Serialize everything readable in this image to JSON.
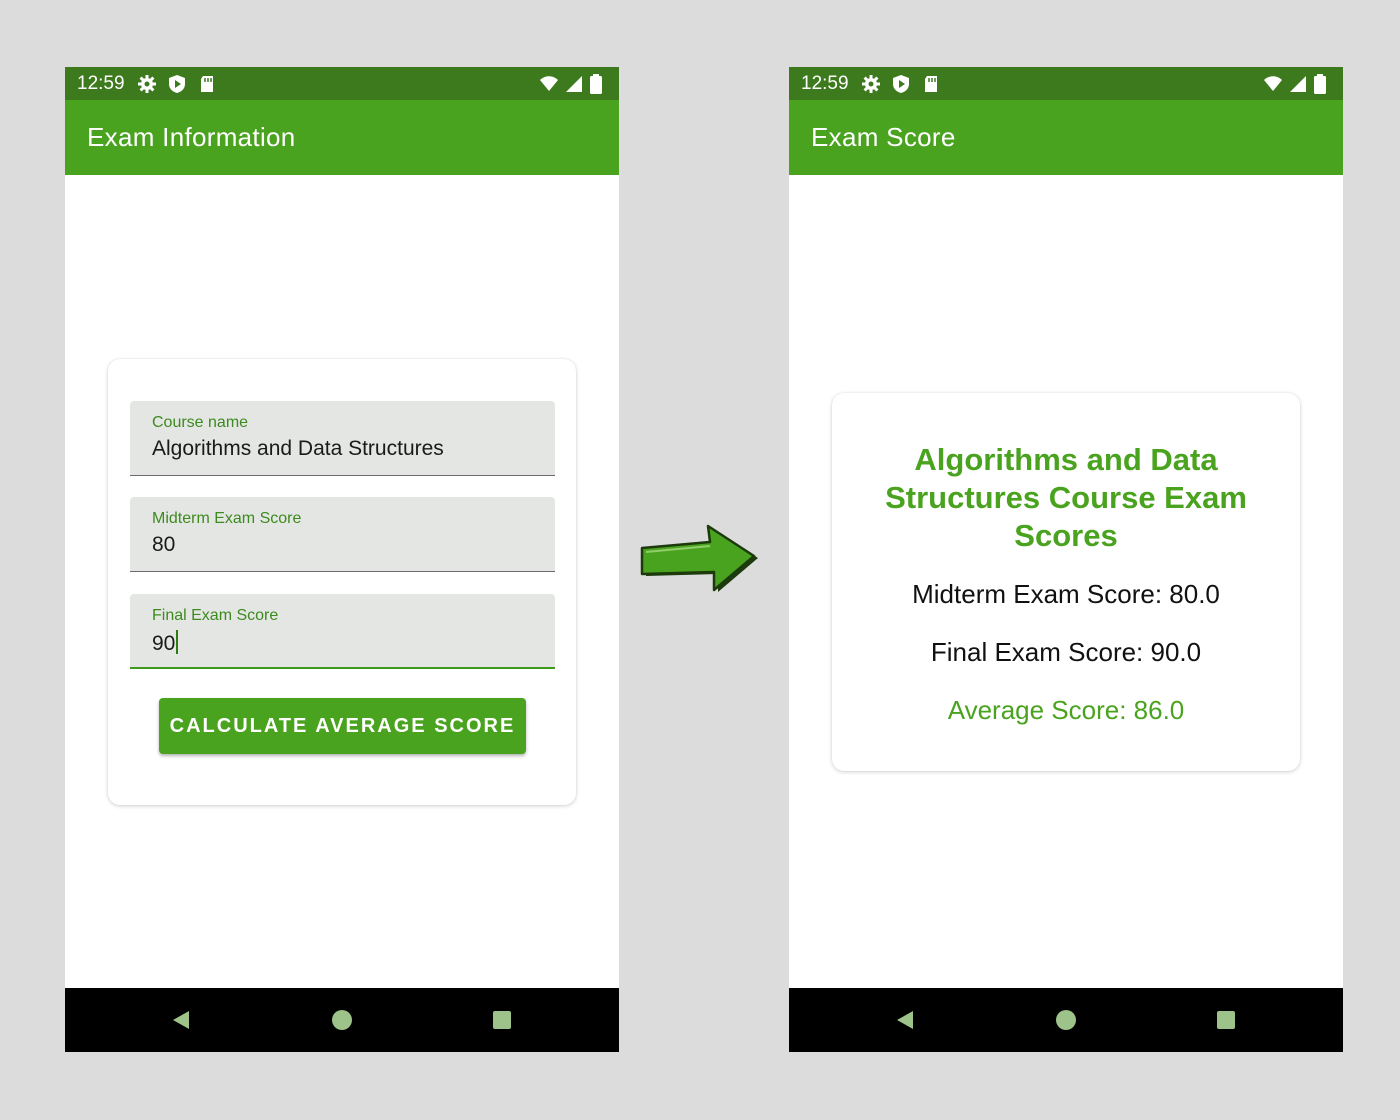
{
  "left_screen": {
    "status_time": "12:59",
    "app_title": "Exam Information",
    "fields": [
      {
        "label": "Course name",
        "value": "Algorithms and Data Structures"
      },
      {
        "label": "Midterm Exam Score",
        "value": "80"
      },
      {
        "label": "Final Exam Score",
        "value": "90"
      }
    ],
    "button_label": "CALCULATE AVERAGE SCORE"
  },
  "right_screen": {
    "status_time": "12:59",
    "app_title": "Exam Score",
    "result_title": "Algorithms and Data Structures Course Exam Scores",
    "midterm_line": "Midterm Exam Score: 80.0",
    "final_line": "Final Exam Score: 90.0",
    "average_line": "Average Score: 86.0"
  },
  "icons": {
    "status_left": [
      "gear-icon",
      "shield-play-icon",
      "sd-card-icon"
    ],
    "status_right": [
      "wifi-icon",
      "signal-icon",
      "battery-icon"
    ],
    "nav": [
      "back-icon",
      "home-icon",
      "recents-icon"
    ],
    "transition": "arrow-right-icon"
  },
  "colors": {
    "status_bar": "#3d7a1e",
    "app_bar": "#4aa31e",
    "accent": "#4aa31e",
    "field_label": "#3d8a1e",
    "background": "#dcdcdc"
  }
}
